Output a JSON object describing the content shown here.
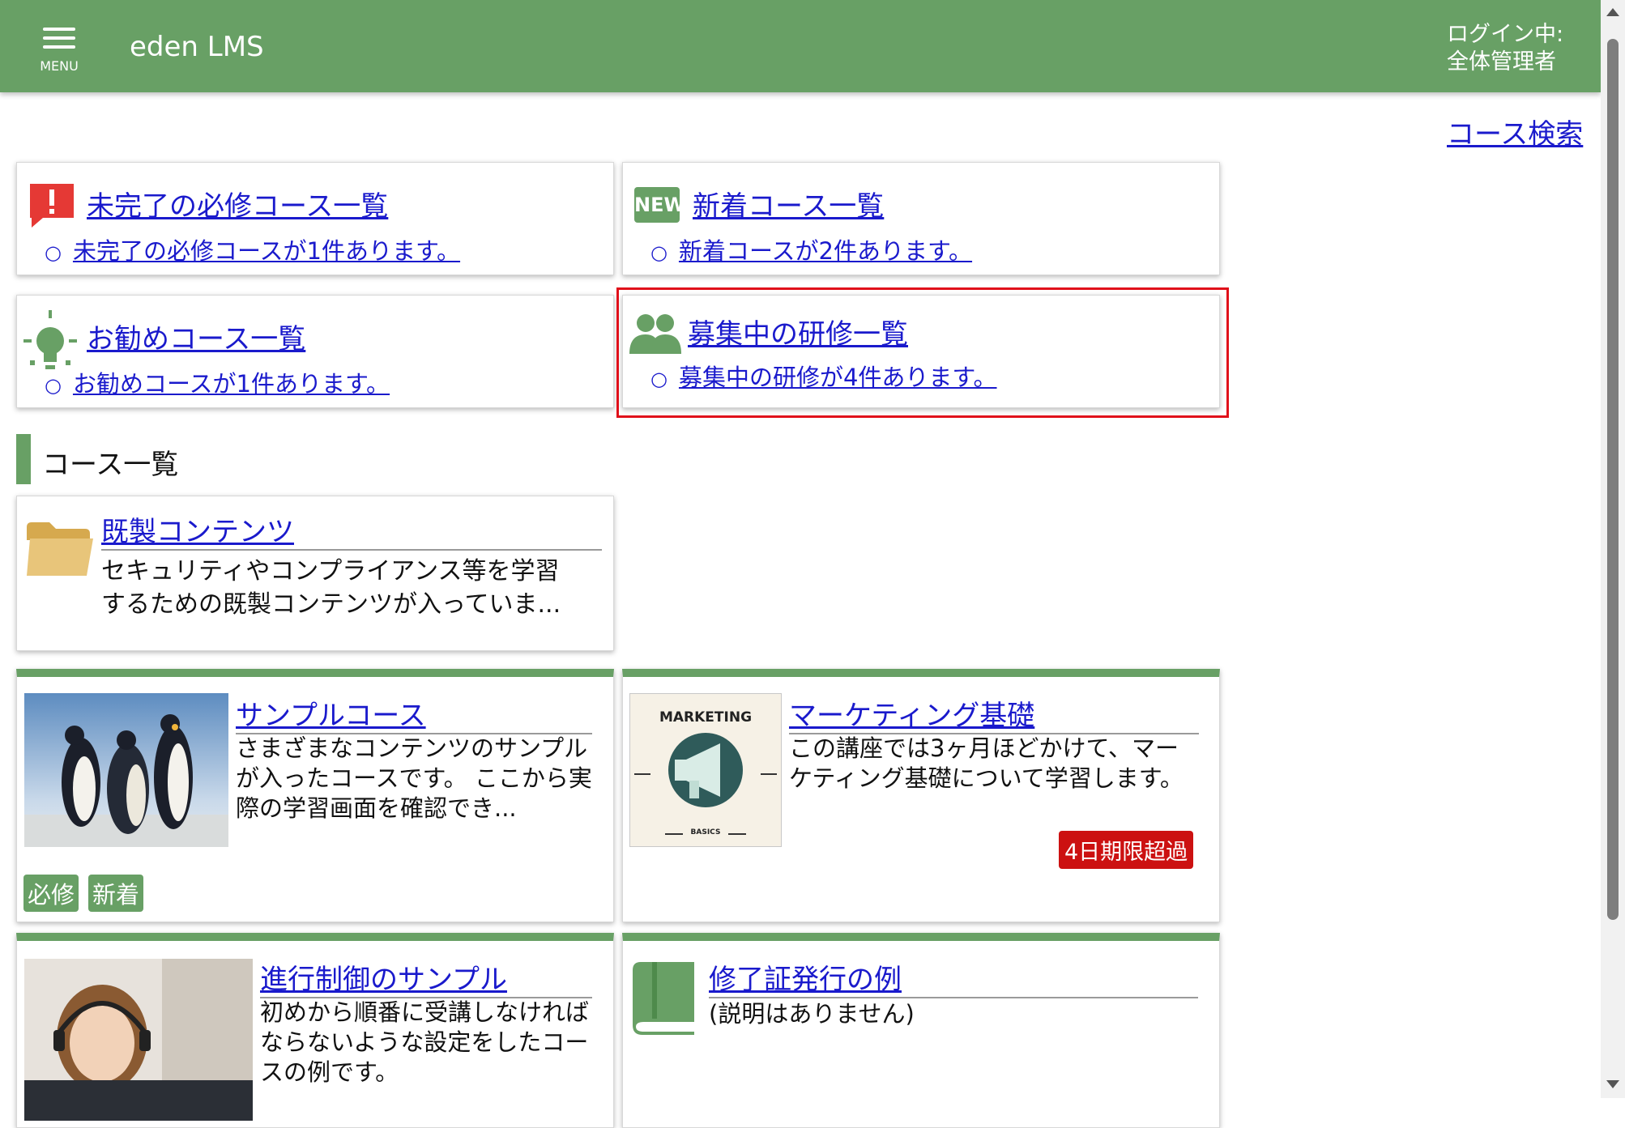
{
  "header": {
    "menu_label": "MENU",
    "app_title": "eden LMS",
    "login_line1": "ログイン中:",
    "login_line2": "全体管理者"
  },
  "course_search_link": "コース検索",
  "info_cards": [
    {
      "title": "未完了の必修コース一覧",
      "bullet": "未完了の必修コースが1件あります。",
      "icon": "alert-icon"
    },
    {
      "title": "新着コース一覧",
      "bullet": "新着コースが2件あります。",
      "icon": "new-icon",
      "icon_text": "NEW"
    },
    {
      "title": "お勧めコース一覧",
      "bullet": "お勧めコースが1件あります。",
      "icon": "lightbulb-icon"
    },
    {
      "title": "募集中の研修一覧",
      "bullet": "募集中の研修が4件あります。",
      "icon": "group-icon"
    }
  ],
  "section_title": "コース一覧",
  "folder_card": {
    "title": "既製コンテンツ",
    "description": "セキュリティやコンプライアンス等を学習するための既製コンテンツが入っていま..."
  },
  "courses": [
    {
      "title": "サンプルコース",
      "description": "さまざまなコンテンツのサンプルが入ったコースです。 ここから実際の学習画面を確認でき...",
      "badges": [
        "必修",
        "新着"
      ],
      "image": "penguins-image"
    },
    {
      "title": "マーケティング基礎",
      "description": "この講座では3ヶ月ほどかけて、マーケティング基礎について学習します。",
      "deadline_badge": "4日期限超過",
      "image": "marketing-image",
      "image_text_top": "MARKETING",
      "image_text_bottom": "BASICS"
    },
    {
      "title": "進行制御のサンプル",
      "description": "初めから順番に受講しなければならないような設定をしたコースの例です。",
      "image": "headset-woman-image"
    },
    {
      "title": "修了証発行の例",
      "description": "(説明はありません)",
      "image": "book-icon"
    }
  ],
  "colors": {
    "header_green": "#68a065",
    "link_blue": "#1a1acc",
    "highlight_red": "#e0101a",
    "alert_red": "#e53935",
    "deadline_red": "#cc1111"
  }
}
